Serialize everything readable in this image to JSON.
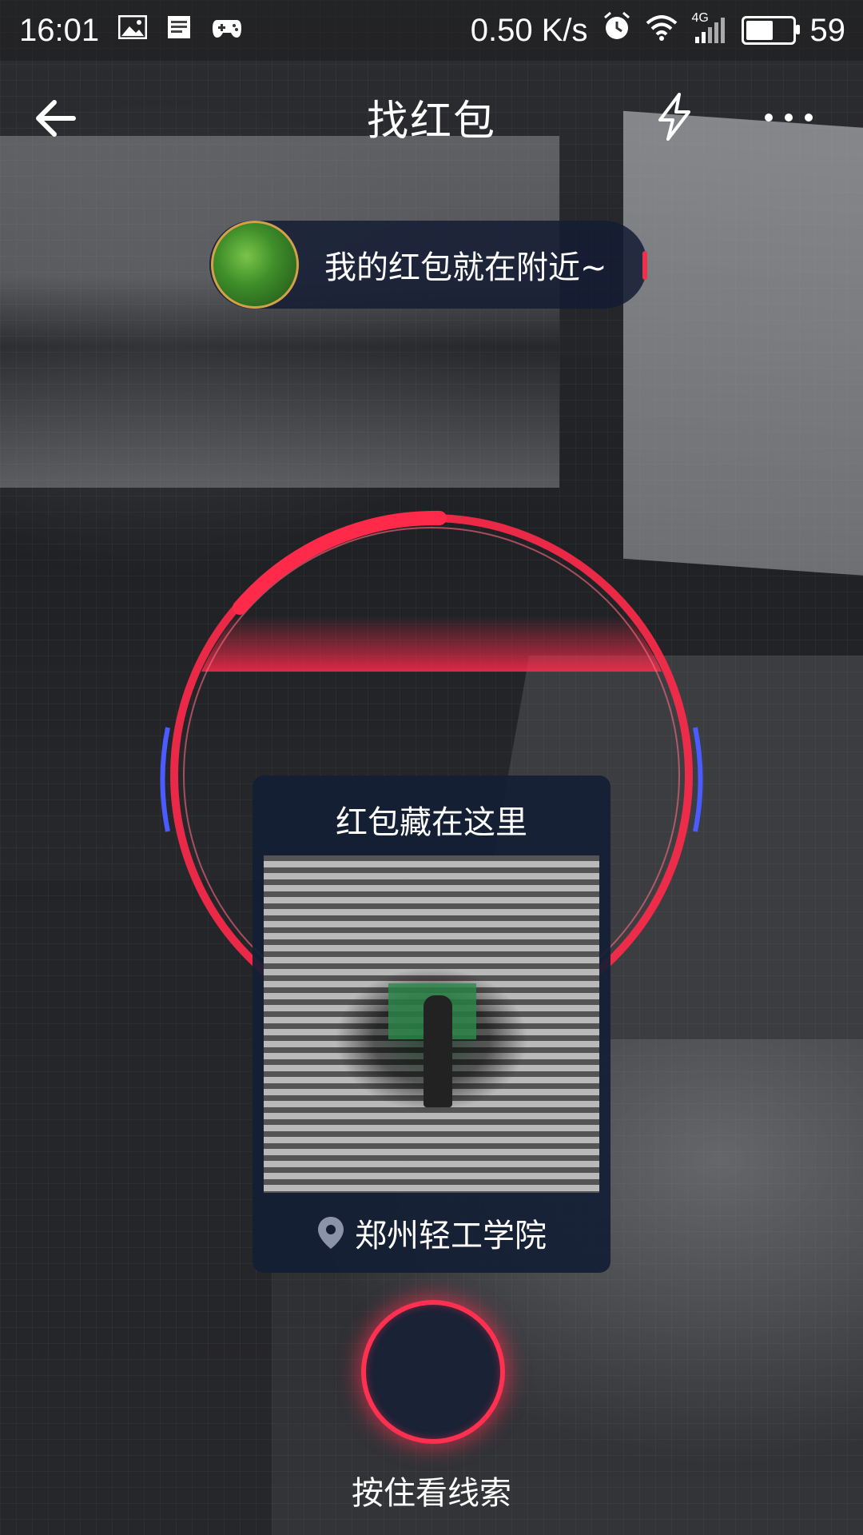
{
  "status_bar": {
    "time": "16:01",
    "net_speed": "0.50 K/s",
    "net_type": "4G",
    "battery_level": "59",
    "battery_fraction": 0.59,
    "icons": [
      "image-icon",
      "notes-icon",
      "gamepad-icon",
      "alarm-icon",
      "wifi-icon",
      "signal-icon",
      "battery-icon"
    ]
  },
  "header": {
    "title": "找红包",
    "icons": [
      "back-arrow-icon",
      "flash-icon",
      "more-icon"
    ]
  },
  "bubble": {
    "text": "我的红包就在附近~"
  },
  "hint_card": {
    "title": "红包藏在这里",
    "location": "郑州轻工学院"
  },
  "press_label": "按住看线索",
  "colors": {
    "accent": "#ff3050",
    "panel": "#141e34",
    "avatar_border": "#d4a04a"
  }
}
